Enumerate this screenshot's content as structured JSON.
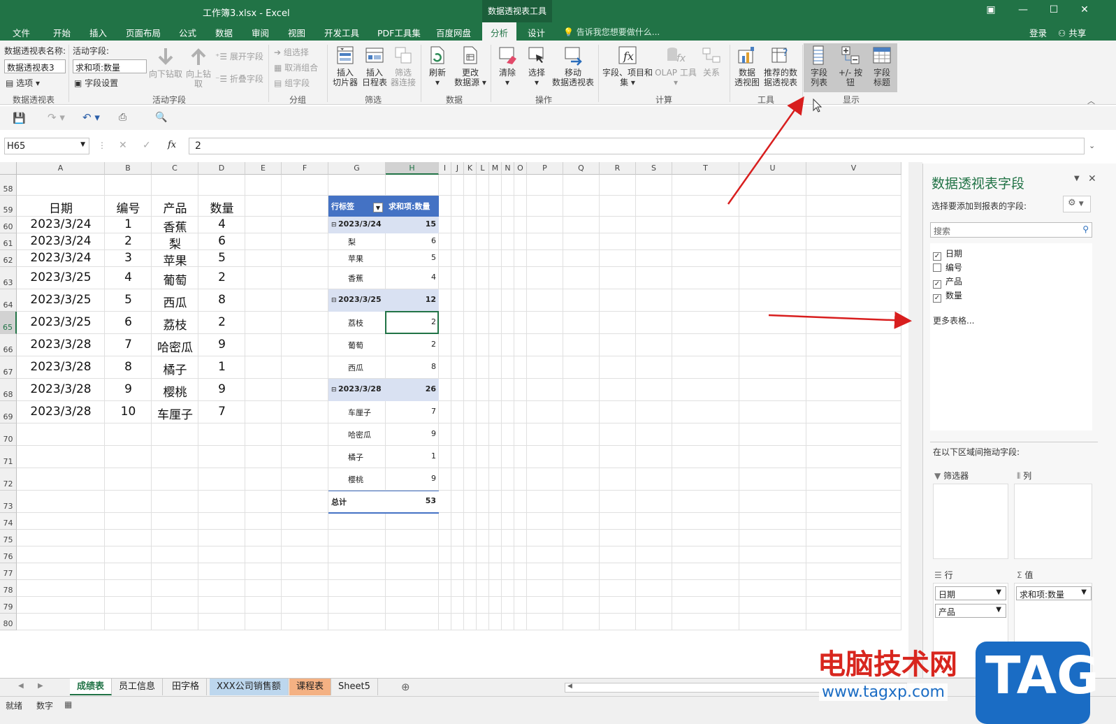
{
  "window": {
    "title": "工作簿3.xlsx - Excel",
    "contextual_tab": "数据透视表工具",
    "login": "登录",
    "share": "共享"
  },
  "tabs": [
    "文件",
    "开始",
    "插入",
    "页面布局",
    "公式",
    "数据",
    "审阅",
    "视图",
    "开发工具",
    "PDF工具集",
    "百度网盘",
    "分析",
    "设计"
  ],
  "active_tab": "分析",
  "tell_me": "告诉我您想要做什么...",
  "ribbon": {
    "pivot_name_label": "数据透视表名称:",
    "pivot_name_value": "数据透视表3",
    "options": "选项",
    "group_pivot": "数据透视表",
    "active_field_label": "活动字段:",
    "active_field_value": "求和项:数量",
    "field_settings": "字段设置",
    "drill_down": "向下钻取",
    "drill_up_1": "向上钻",
    "drill_up_2": "取",
    "expand_field": "展开字段",
    "collapse_field": "折叠字段",
    "group_active_field": "活动字段",
    "group_selection": "组选择",
    "ungroup": "取消组合",
    "group_field": "组字段",
    "group_group": "分组",
    "insert_slicer_1": "插入",
    "insert_slicer_2": "切片器",
    "insert_timeline_1": "插入",
    "insert_timeline_2": "日程表",
    "filter_conn_1": "筛选",
    "filter_conn_2": "器连接",
    "group_filter": "筛选",
    "refresh": "刷新",
    "change_source_1": "更改",
    "change_source_2": "数据源",
    "group_data": "数据",
    "clear": "清除",
    "select": "选择",
    "move_1": "移动",
    "move_2": "数据透视表",
    "group_actions": "操作",
    "fields_items_1": "字段、项目和",
    "fields_items_2": "集",
    "olap": "OLAP 工具",
    "relations": "关系",
    "group_calc": "计算",
    "pivotchart_1": "数据",
    "pivotchart_2": "透视图",
    "recommended_1": "推荐的数",
    "recommended_2": "据透视表",
    "group_tools": "工具",
    "field_list_1": "字段",
    "field_list_2": "列表",
    "buttons": "+/- 按钮",
    "field_headers_1": "字段",
    "field_headers_2": "标题",
    "group_show": "显示"
  },
  "formula": {
    "name_box": "H65",
    "fx": "fx",
    "value": "2"
  },
  "columns": [
    "A",
    "B",
    "C",
    "D",
    "E",
    "F",
    "G",
    "H",
    "I",
    "J",
    "K",
    "L",
    "M",
    "N",
    "O",
    "P",
    "Q",
    "R",
    "S",
    "T",
    "U",
    "V"
  ],
  "rows": [
    "58",
    "59",
    "60",
    "61",
    "62",
    "63",
    "64",
    "65",
    "66",
    "67",
    "68",
    "69",
    "70",
    "71",
    "72",
    "73",
    "74",
    "75",
    "76",
    "77",
    "78",
    "79",
    "80"
  ],
  "source_table": {
    "headers": [
      "日期",
      "编号",
      "产品",
      "数量"
    ],
    "rows": [
      [
        "2023/3/24",
        "1",
        "香蕉",
        "4"
      ],
      [
        "2023/3/24",
        "2",
        "梨",
        "6"
      ],
      [
        "2023/3/24",
        "3",
        "苹果",
        "5"
      ],
      [
        "2023/3/25",
        "4",
        "葡萄",
        "2"
      ],
      [
        "2023/3/25",
        "5",
        "西瓜",
        "8"
      ],
      [
        "2023/3/25",
        "6",
        "荔枝",
        "2"
      ],
      [
        "2023/3/28",
        "7",
        "哈密瓜",
        "9"
      ],
      [
        "2023/3/28",
        "8",
        "橘子",
        "1"
      ],
      [
        "2023/3/28",
        "9",
        "樱桃",
        "9"
      ],
      [
        "2023/3/28",
        "10",
        "车厘子",
        "7"
      ]
    ]
  },
  "pivot": {
    "row_label": "行标签",
    "value_label": "求和项:数量",
    "groups": [
      {
        "name": "2023/3/24",
        "total": "15",
        "items": [
          [
            "梨",
            "6"
          ],
          [
            "苹果",
            "5"
          ],
          [
            "香蕉",
            "4"
          ]
        ]
      },
      {
        "name": "2023/3/25",
        "total": "12",
        "items": [
          [
            "荔枝",
            "2"
          ],
          [
            "葡萄",
            "2"
          ],
          [
            "西瓜",
            "8"
          ]
        ]
      },
      {
        "name": "2023/3/28",
        "total": "26",
        "items": [
          [
            "车厘子",
            "7"
          ],
          [
            "哈密瓜",
            "9"
          ],
          [
            "橘子",
            "1"
          ],
          [
            "樱桃",
            "9"
          ]
        ]
      }
    ],
    "grand_total_label": "总计",
    "grand_total": "53"
  },
  "sheets": [
    "成绩表",
    "员工信息",
    "田字格",
    "XXX公司销售额",
    "课程表",
    "Sheet5"
  ],
  "active_sheet": "成绩表",
  "status": {
    "ready": "就绪",
    "num": "数字"
  },
  "pane": {
    "title": "数据透视表字段",
    "choose_label": "选择要添加到报表的字段:",
    "search_placeholder": "搜索",
    "fields": [
      {
        "name": "日期",
        "checked": true
      },
      {
        "name": "编号",
        "checked": false
      },
      {
        "name": "产品",
        "checked": true
      },
      {
        "name": "数量",
        "checked": true
      }
    ],
    "more_tables": "更多表格...",
    "drag_label": "在以下区域间拖动字段:",
    "filters": "筛选器",
    "columns": "列",
    "rows_area": "行",
    "values": "值",
    "row_fields": [
      "日期",
      "产品"
    ],
    "value_fields": [
      "求和项:数量"
    ]
  },
  "watermark": {
    "brand": "电脑技术网",
    "url": "www.tagxp.com",
    "logo": "TAG"
  },
  "colors": {
    "excel_green": "#217346",
    "pivot_header": "#4472c4",
    "pivot_group": "#d9e1f2",
    "arrow": "#d81e1e"
  }
}
